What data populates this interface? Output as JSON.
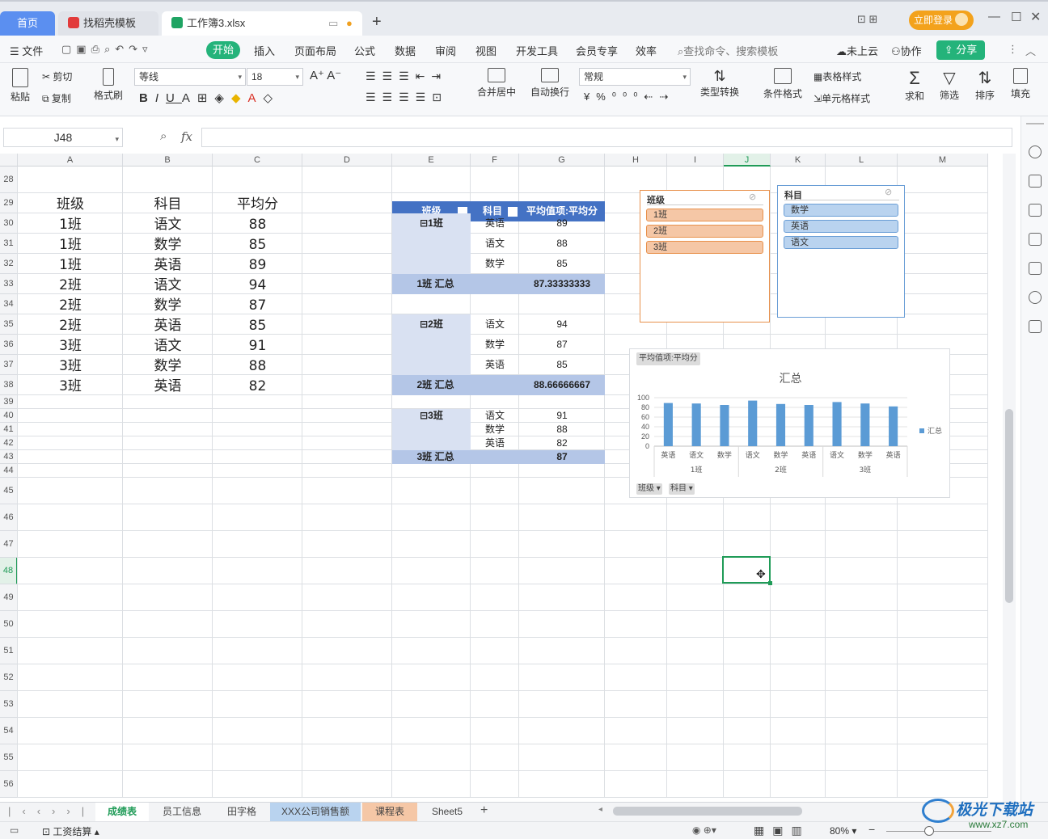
{
  "titlebar": {
    "tabs": [
      {
        "label": "首页"
      },
      {
        "label": "找稻壳模板"
      },
      {
        "label": "工作簿3.xlsx"
      }
    ],
    "login": "立即登录"
  },
  "menubar": {
    "file": "文件",
    "items": [
      "开始",
      "插入",
      "页面布局",
      "公式",
      "数据",
      "审阅",
      "视图",
      "开发工具",
      "会员专享",
      "效率"
    ],
    "search": "查找命令、搜索模板",
    "cloud": "未上云",
    "collab": "协作",
    "share": "分享"
  },
  "ribbon": {
    "paste": "粘贴",
    "cut": "剪切",
    "copy": "复制",
    "format_painter": "格式刷",
    "font_name": "等线",
    "font_size": "18",
    "merge": "合并居中",
    "wrap": "自动换行",
    "number_format": "常规",
    "convert": "类型转换",
    "cond_format": "条件格式",
    "table_style": "表格样式",
    "cell_style": "单元格样式",
    "sum": "求和",
    "filter": "筛选",
    "sort": "排序",
    "fill": "填充"
  },
  "formula": {
    "name_box": "J48",
    "fx": "fx",
    "value": ""
  },
  "columns": [
    "A",
    "B",
    "C",
    "D",
    "E",
    "F",
    "G",
    "H",
    "I",
    "J",
    "K",
    "L",
    "M"
  ],
  "rows": [
    "28",
    "29",
    "30",
    "31",
    "32",
    "33",
    "34",
    "35",
    "36",
    "37",
    "38",
    "39",
    "40",
    "41",
    "42",
    "43",
    "44",
    "45",
    "46",
    "47",
    "48",
    "49",
    "50",
    "51",
    "52",
    "53",
    "54",
    "55",
    "56"
  ],
  "table": {
    "headers": [
      "班级",
      "科目",
      "平均分"
    ],
    "data": [
      [
        "1班",
        "语文",
        "88"
      ],
      [
        "1班",
        "数学",
        "85"
      ],
      [
        "1班",
        "英语",
        "89"
      ],
      [
        "2班",
        "语文",
        "94"
      ],
      [
        "2班",
        "数学",
        "87"
      ],
      [
        "2班",
        "英语",
        "85"
      ],
      [
        "3班",
        "语文",
        "91"
      ],
      [
        "3班",
        "数学",
        "88"
      ],
      [
        "3班",
        "英语",
        "82"
      ]
    ]
  },
  "pivot": {
    "header": [
      "班级",
      "科目",
      "平均值项:平均分"
    ],
    "groups": [
      {
        "name": "⊟1班",
        "rows": [
          [
            "英语",
            "89"
          ],
          [
            "语文",
            "88"
          ],
          [
            "数学",
            "85"
          ]
        ],
        "total_label": "1班 汇总",
        "total": "87.33333333"
      },
      {
        "name": "⊟2班",
        "rows": [
          [
            "语文",
            "94"
          ],
          [
            "数学",
            "87"
          ],
          [
            "英语",
            "85"
          ]
        ],
        "total_label": "2班 汇总",
        "total": "88.66666667"
      },
      {
        "name": "⊟3班",
        "rows": [
          [
            "语文",
            "91"
          ],
          [
            "数学",
            "88"
          ],
          [
            "英语",
            "82"
          ]
        ],
        "total_label": "3班 汇总",
        "total": "87"
      }
    ]
  },
  "slicers": {
    "class": {
      "title": "班级",
      "items": [
        "1班",
        "2班",
        "3班"
      ],
      "color": "#f5c7a6",
      "border": "#e8914c"
    },
    "subject": {
      "title": "科目",
      "items": [
        "数学",
        "英语",
        "语文"
      ],
      "color": "#b9d3ef",
      "border": "#6a9ed6"
    }
  },
  "chart_data": {
    "type": "bar",
    "title": "汇总",
    "field_button": "平均值项:平均分",
    "categories": [
      "英语",
      "语文",
      "数学",
      "语文",
      "数学",
      "英语",
      "语文",
      "数学",
      "英语"
    ],
    "groups": [
      "1班",
      "2班",
      "3班"
    ],
    "series": [
      {
        "name": "汇总",
        "values": [
          89,
          88,
          85,
          94,
          87,
          85,
          91,
          88,
          82
        ]
      }
    ],
    "yticks": [
      "100",
      "80",
      "60",
      "40",
      "20",
      "0"
    ],
    "ylim": [
      0,
      100
    ],
    "legend": "right",
    "color": "#5b9bd5",
    "filter_buttons": [
      "班级",
      "科目"
    ]
  },
  "sheets": [
    {
      "label": "成绩表",
      "active": true
    },
    {
      "label": "员工信息"
    },
    {
      "label": "田字格"
    },
    {
      "label": "XXX公司销售额"
    },
    {
      "label": "课程表"
    },
    {
      "label": "Sheet5"
    }
  ],
  "status": {
    "macro": "工资结算",
    "zoom": "80%"
  },
  "watermark": {
    "text": "极光下载站",
    "url": "www.xz7.com"
  }
}
